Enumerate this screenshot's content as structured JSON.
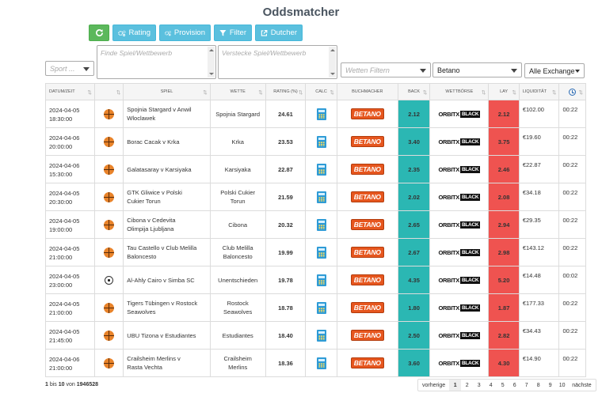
{
  "page": {
    "title": "Oddsmatcher"
  },
  "toolbar": {
    "refresh_label": "",
    "rating_label": "Rating",
    "provision_label": "Provision",
    "filter_label": "Filter",
    "dutcher_label": "Dutcher"
  },
  "filters": {
    "sport_placeholder": "Sport ...",
    "find_placeholder": "Finde Spiel/Wettbewerb",
    "hide_placeholder": "Verstecke Spiel/Wettbewerb",
    "bets_placeholder": "Wetten Filtern",
    "bookmaker_value": "Betano",
    "exchange_value": "Alle Exchange"
  },
  "table": {
    "headers": {
      "date": "Datum/Zeit",
      "game": "Spiel",
      "bet": "Wette",
      "rating": "Rating (%)",
      "calc": "Calc",
      "bookmaker": "Buchmacher",
      "back": "Back",
      "exchange": "Wettbörse",
      "lay": "Lay",
      "liquidity": "Liquidität"
    },
    "rows": [
      {
        "date": "2024-04-05",
        "time": "18:30:00",
        "sport": "basketball",
        "game1": "Spojnia Stargard v Anwil",
        "game2": "Wloclawek",
        "bet1": "Spojnia Stargard",
        "bet2": "",
        "rating": "24.61",
        "bookmaker": "BETANO",
        "back": "2.12",
        "exchange": "ORBITX",
        "exchange_tag": "BLACK",
        "lay": "2.12",
        "liquidity": "€102.00",
        "countdown": "00:22"
      },
      {
        "date": "2024-04-06",
        "time": "20:00:00",
        "sport": "basketball",
        "game1": "Borac Cacak v Krka",
        "game2": "",
        "bet1": "Krka",
        "bet2": "",
        "rating": "23.53",
        "bookmaker": "BETANO",
        "back": "3.40",
        "exchange": "ORBITX",
        "exchange_tag": "BLACK",
        "lay": "3.75",
        "liquidity": "€19.60",
        "countdown": "00:22"
      },
      {
        "date": "2024-04-06",
        "time": "15:30:00",
        "sport": "basketball",
        "game1": "Galatasaray v Karsiyaka",
        "game2": "",
        "bet1": "Karsiyaka",
        "bet2": "",
        "rating": "22.87",
        "bookmaker": "BETANO",
        "back": "2.35",
        "exchange": "ORBITX",
        "exchange_tag": "BLACK",
        "lay": "2.46",
        "liquidity": "€22.87",
        "countdown": "00:22"
      },
      {
        "date": "2024-04-05",
        "time": "20:30:00",
        "sport": "basketball",
        "game1": "GTK Gliwice v Polski",
        "game2": "Cukier Torun",
        "bet1": "Polski Cukier",
        "bet2": "Torun",
        "rating": "21.59",
        "bookmaker": "BETANO",
        "back": "2.02",
        "exchange": "ORBITX",
        "exchange_tag": "BLACK",
        "lay": "2.08",
        "liquidity": "€34.18",
        "countdown": "00:22"
      },
      {
        "date": "2024-04-05",
        "time": "19:00:00",
        "sport": "basketball",
        "game1": "Cibona v Cedevita",
        "game2": "Olimpija Ljubljana",
        "bet1": "Cibona",
        "bet2": "",
        "rating": "20.32",
        "bookmaker": "BETANO",
        "back": "2.65",
        "exchange": "ORBITX",
        "exchange_tag": "BLACK",
        "lay": "2.94",
        "liquidity": "€29.35",
        "countdown": "00:22"
      },
      {
        "date": "2024-04-05",
        "time": "21:00:00",
        "sport": "basketball",
        "game1": "Tau Castello v Club Melilla",
        "game2": "Baloncesto",
        "bet1": "Club Melilla",
        "bet2": "Baloncesto",
        "rating": "19.99",
        "bookmaker": "BETANO",
        "back": "2.67",
        "exchange": "ORBITX",
        "exchange_tag": "BLACK",
        "lay": "2.98",
        "liquidity": "€143.12",
        "countdown": "00:22"
      },
      {
        "date": "2024-04-05",
        "time": "23:00:00",
        "sport": "soccer",
        "game1": "Al-Ahly Cairo v Simba SC",
        "game2": "",
        "bet1": "Unentschieden",
        "bet2": "",
        "rating": "19.78",
        "bookmaker": "BETANO",
        "back": "4.35",
        "exchange": "ORBITX",
        "exchange_tag": "BLACK",
        "lay": "5.20",
        "liquidity": "€14.48",
        "countdown": "00:02"
      },
      {
        "date": "2024-04-05",
        "time": "21:00:00",
        "sport": "basketball",
        "game1": "Tigers Tübingen v Rostock",
        "game2": "Seawolves",
        "bet1": "Rostock",
        "bet2": "Seawolves",
        "rating": "18.78",
        "bookmaker": "BETANO",
        "back": "1.80",
        "exchange": "ORBITX",
        "exchange_tag": "BLACK",
        "lay": "1.87",
        "liquidity": "€177.33",
        "countdown": "00:22"
      },
      {
        "date": "2024-04-05",
        "time": "21:45:00",
        "sport": "basketball",
        "game1": "UBU Tizona v Estudiantes",
        "game2": "",
        "bet1": "Estudiantes",
        "bet2": "",
        "rating": "18.40",
        "bookmaker": "BETANO",
        "back": "2.50",
        "exchange": "ORBITX",
        "exchange_tag": "BLACK",
        "lay": "2.82",
        "liquidity": "€34.43",
        "countdown": "00:22"
      },
      {
        "date": "2024-04-06",
        "time": "21:00:00",
        "sport": "basketball",
        "game1": "Crailsheim Merlins v",
        "game2": "Rasta Vechta",
        "bet1": "Crailsheim",
        "bet2": "Merlins",
        "rating": "18.36",
        "bookmaker": "BETANO",
        "back": "3.60",
        "exchange": "ORBITX",
        "exchange_tag": "BLACK",
        "lay": "4.30",
        "liquidity": "€14.90",
        "countdown": "00:22"
      }
    ]
  },
  "footer": {
    "range_from": "1",
    "range_word": "bis",
    "range_to": "10",
    "of_word": "von",
    "total": "1946528",
    "pager": {
      "prev": "vorherige",
      "pages": [
        "1",
        "2",
        "3",
        "4",
        "5",
        "6",
        "7",
        "8",
        "9",
        "10"
      ],
      "current": "1",
      "next": "nächste"
    }
  }
}
